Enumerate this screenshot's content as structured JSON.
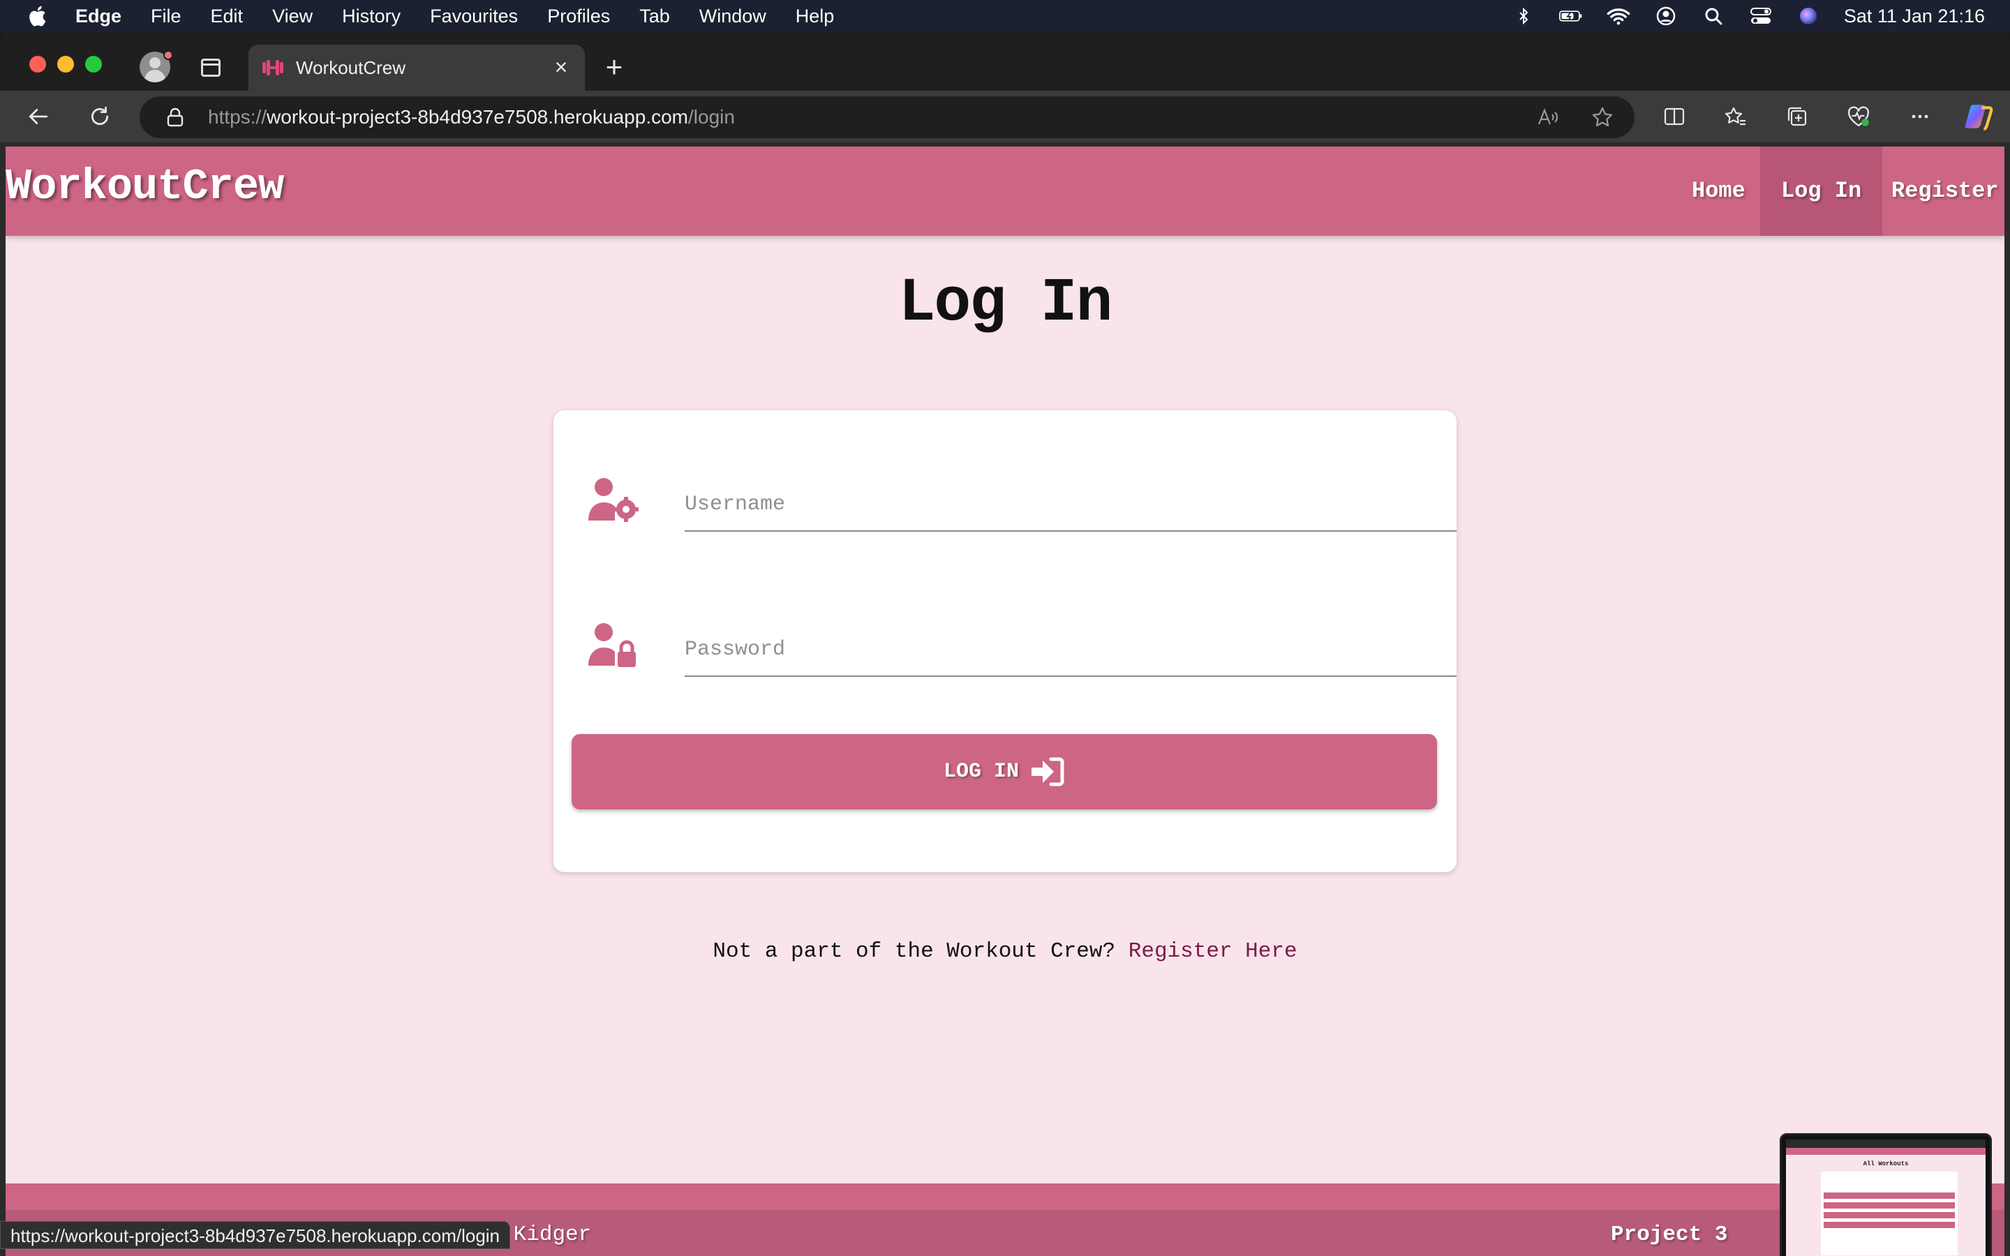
{
  "menubar": {
    "app_name": "Edge",
    "items": [
      "File",
      "Edit",
      "View",
      "History",
      "Favourites",
      "Profiles",
      "Tab",
      "Window",
      "Help"
    ],
    "datetime": "Sat 11 Jan  21:16"
  },
  "browser": {
    "tab_title": "WorkoutCrew",
    "url_scheme": "https://",
    "url_host": "workout-project3-8b4d937e7508.herokuapp.com",
    "url_path": "/login",
    "status_url": "https://workout-project3-8b4d937e7508.herokuapp.com/login"
  },
  "site": {
    "brand": "WorkoutCrew",
    "nav": {
      "home": "Home",
      "login": "Log In",
      "register": "Register"
    },
    "heading": "Log In",
    "form": {
      "username_placeholder": "Username",
      "password_placeholder": "Password",
      "username_value": "",
      "password_value": "",
      "submit_label": "LOG IN"
    },
    "register_prompt": "Not a part of the Workout Crew?",
    "register_link": "Register Here",
    "footer": {
      "copyright": "© 2024 Georgina Kidger",
      "project": "Project 3"
    },
    "accent_color": "#cd6584",
    "background_color": "#f9e4ec"
  },
  "thumbnail": {
    "title": "All Workouts"
  }
}
